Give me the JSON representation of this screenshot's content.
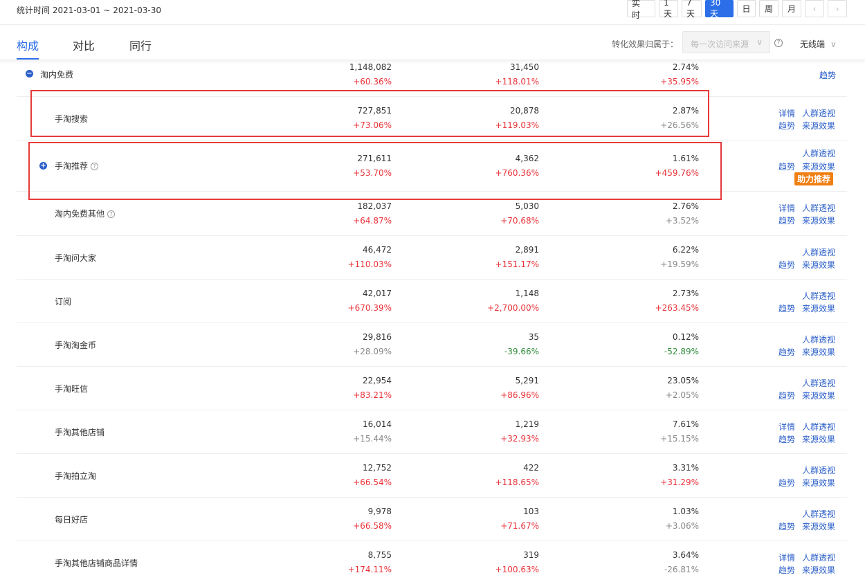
{
  "header": {
    "date_range": "统计时间 2021-03-01 ~ 2021-03-30",
    "buttons": [
      "实 时",
      "1天",
      "7天",
      "30天",
      "日",
      "周",
      "月"
    ],
    "active_button": "30天",
    "prev_icon": "chevron-left-icon",
    "next_icon": "chevron-right-icon"
  },
  "tabs": {
    "items": [
      "构成",
      "对比",
      "同行"
    ],
    "active": "构成",
    "attribution_label": "转化效果归属于：",
    "attribution_value": "每一次访问来源",
    "device": "无线端"
  },
  "colors": {
    "accent": "#2b6ee8",
    "positive": "#e8333a",
    "negative": "#2e8b3a",
    "badge": "#f07f12",
    "highlight": "#e63a3a"
  },
  "rows": [
    {
      "name": "淘内免费",
      "toggle": "−",
      "v1": "1,148,082",
      "c1": "+60.36%",
      "v2": "31,450",
      "c2": "+118.01%",
      "v3": "2.74%",
      "c3": "+35.95%",
      "a_trend": "趋势"
    },
    {
      "name": "手淘搜索",
      "v1": "727,851",
      "c1": "+73.06%",
      "v2": "20,878",
      "c2": "+119.03%",
      "v3": "2.87%",
      "c3": "+26.56%",
      "a_detail": "详情",
      "a_crowd": "人群透视",
      "a_trend": "趋势",
      "a_source": "来源效果"
    },
    {
      "name": "手淘推荐",
      "toggle": "+",
      "v1": "271,611",
      "c1": "+53.70%",
      "v2": "4,362",
      "c2": "+760.36%",
      "v3": "1.61%",
      "c3": "+459.76%",
      "a_crowd": "人群透视",
      "a_trend": "趋势",
      "a_source": "来源效果",
      "badge": "助力推荐"
    },
    {
      "name": "淘内免费其他",
      "v1": "182,037",
      "c1": "+64.87%",
      "v2": "5,030",
      "c2": "+70.68%",
      "v3": "2.76%",
      "c3": "+3.52%",
      "a_detail": "详情",
      "a_crowd": "人群透视",
      "a_trend": "趋势",
      "a_source": "来源效果"
    },
    {
      "name": "手淘问大家",
      "v1": "46,472",
      "c1": "+110.03%",
      "v2": "2,891",
      "c2": "+151.17%",
      "v3": "6.22%",
      "c3": "+19.59%",
      "a_crowd": "人群透视",
      "a_trend": "趋势",
      "a_source": "来源效果"
    },
    {
      "name": "订阅",
      "v1": "42,017",
      "c1": "+670.39%",
      "v2": "1,148",
      "c2": "+2,700.00%",
      "v3": "2.73%",
      "c3": "+263.45%",
      "a_crowd": "人群透视",
      "a_trend": "趋势",
      "a_source": "来源效果"
    },
    {
      "name": "手淘淘金币",
      "v1": "29,816",
      "c1": "+28.09%",
      "v2": "35",
      "c2": "-39.66%",
      "v3": "0.12%",
      "c3": "-52.89%",
      "a_crowd": "人群透视",
      "a_trend": "趋势",
      "a_source": "来源效果"
    },
    {
      "name": "手淘旺信",
      "v1": "22,954",
      "c1": "+83.21%",
      "v2": "5,291",
      "c2": "+86.96%",
      "v3": "23.05%",
      "c3": "+2.05%",
      "a_crowd": "人群透视",
      "a_trend": "趋势",
      "a_source": "来源效果"
    },
    {
      "name": "手淘其他店铺",
      "v1": "16,014",
      "c1": "+15.44%",
      "v2": "1,219",
      "c2": "+32.93%",
      "v3": "7.61%",
      "c3": "+15.15%",
      "a_detail": "详情",
      "a_crowd": "人群透视",
      "a_trend": "趋势",
      "a_source": "来源效果"
    },
    {
      "name": "手淘拍立淘",
      "v1": "12,752",
      "c1": "+66.54%",
      "v2": "422",
      "c2": "+118.65%",
      "v3": "3.31%",
      "c3": "+31.29%",
      "a_crowd": "人群透视",
      "a_trend": "趋势",
      "a_source": "来源效果"
    },
    {
      "name": "每日好店",
      "v1": "9,978",
      "c1": "+66.58%",
      "v2": "103",
      "c2": "+71.67%",
      "v3": "1.03%",
      "c3": "+3.06%",
      "a_crowd": "人群透视",
      "a_trend": "趋势",
      "a_source": "来源效果"
    },
    {
      "name": "手淘其他店铺商品详情",
      "v1": "8,755",
      "c1": "+174.11%",
      "v2": "319",
      "c2": "+100.63%",
      "v3": "3.64%",
      "c3": "-26.81%",
      "a_detail": "详情",
      "a_crowd": "人群透视",
      "a_trend": "趋势",
      "a_source": "来源效果"
    }
  ]
}
